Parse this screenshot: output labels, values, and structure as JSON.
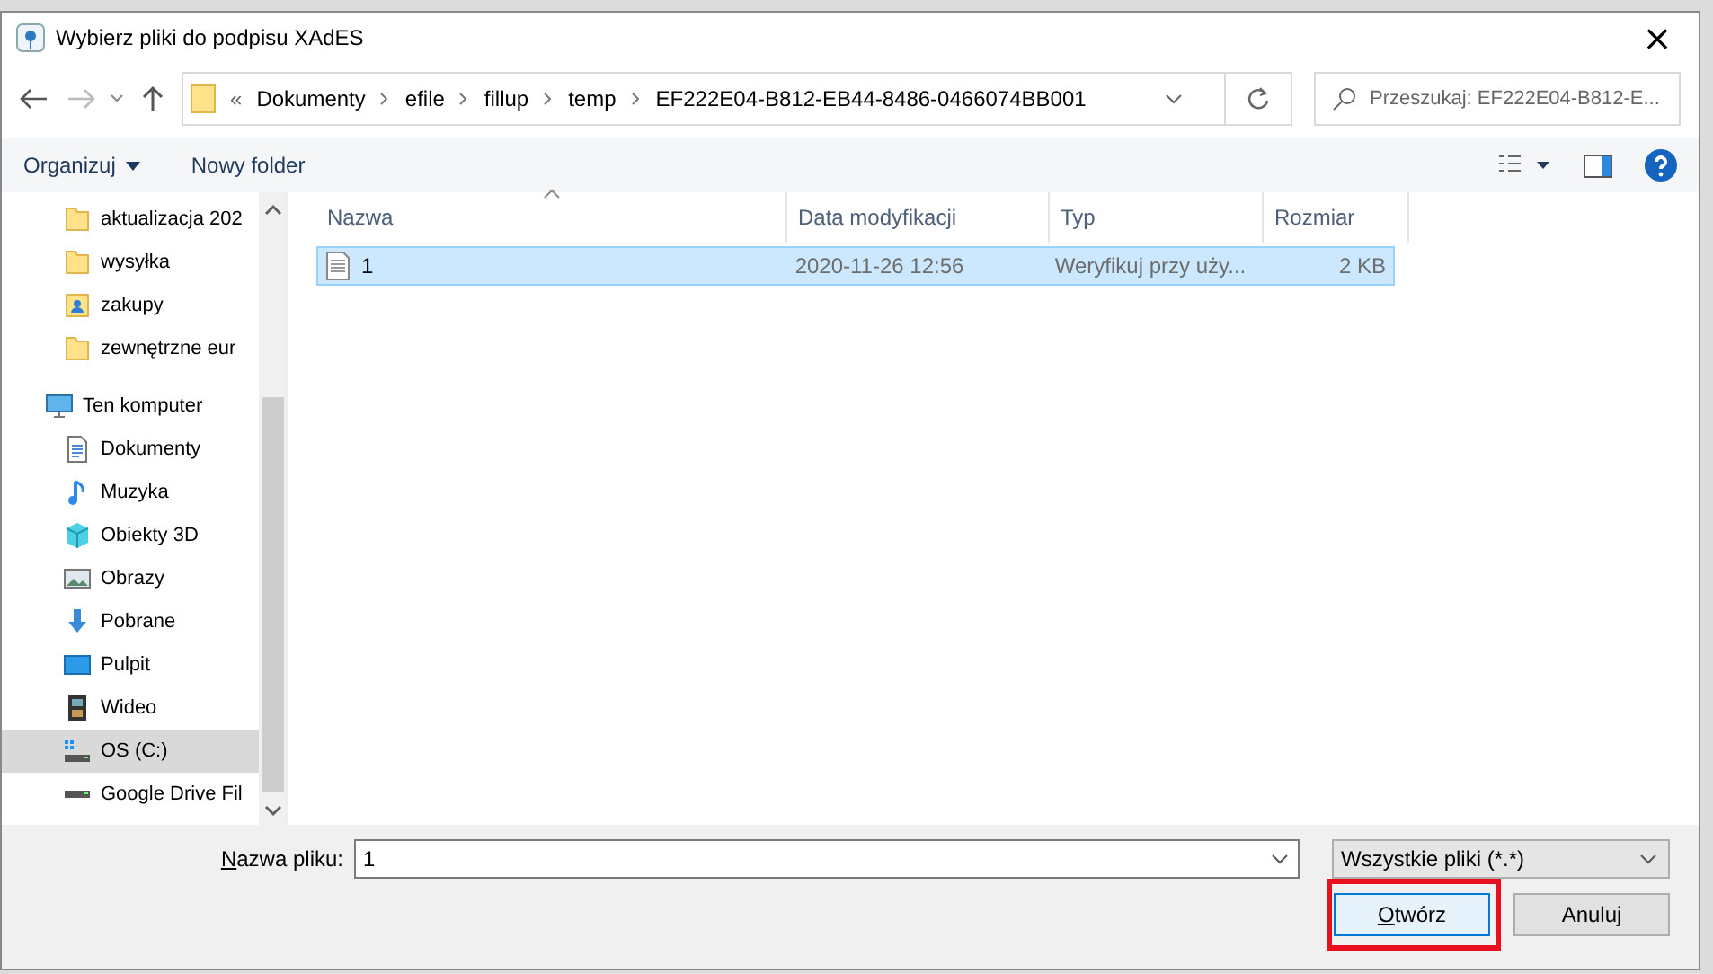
{
  "window": {
    "title": "Wybierz pliki do podpisu XAdES",
    "close": "×"
  },
  "address_bar": {
    "overflow": "«",
    "path": [
      "Dokumenty",
      "efile",
      "fillup",
      "temp",
      "EF222E04-B812-EB44-8486-0466074BB001"
    ]
  },
  "search": {
    "placeholder": "Przeszukaj: EF222E04-B812-E..."
  },
  "toolbar": {
    "organize": "Organizuj",
    "new_folder": "Nowy folder"
  },
  "sidebar": {
    "items": [
      {
        "label": "aktualizacja 202",
        "kind": "folder",
        "selected": false
      },
      {
        "label": "wysyłka",
        "kind": "folder",
        "selected": false
      },
      {
        "label": "zakupy",
        "kind": "user-folder",
        "selected": false
      },
      {
        "label": "zewnętrzne eur",
        "kind": "folder",
        "selected": false
      },
      {
        "label": "Ten komputer",
        "kind": "computer",
        "selected": false,
        "children": [
          {
            "label": "Dokumenty",
            "kind": "document",
            "selected": false
          },
          {
            "label": "Muzyka",
            "kind": "music",
            "selected": false
          },
          {
            "label": "Obiekty 3D",
            "kind": "cube",
            "selected": false
          },
          {
            "label": "Obrazy",
            "kind": "image",
            "selected": false
          },
          {
            "label": "Pobrane",
            "kind": "download",
            "selected": false
          },
          {
            "label": "Pulpit",
            "kind": "desktop",
            "selected": false
          },
          {
            "label": "Wideo",
            "kind": "film",
            "selected": false
          },
          {
            "label": "OS (C:)",
            "kind": "system-drive",
            "selected": true
          },
          {
            "label": "Google Drive Fil",
            "kind": "drive",
            "selected": false
          }
        ]
      }
    ]
  },
  "table": {
    "columns": [
      {
        "label": "Nazwa",
        "sorted": true
      },
      {
        "label": "Data modyfikacji",
        "sorted": false
      },
      {
        "label": "Typ",
        "sorted": false
      },
      {
        "label": "Rozmiar",
        "sorted": false
      }
    ],
    "rows": [
      {
        "cells": [
          "1",
          "2020-11-26 12:56",
          "Weryfikuj przy uży...",
          "2 KB"
        ],
        "selected": true
      }
    ]
  },
  "footer": {
    "filename_label": "Nazwa pliku:",
    "filename": "1",
    "filter": "Wszystkie pliki (*.*)",
    "open_button": {
      "label": "Otwórz",
      "highlighted": true
    },
    "cancel_button": "Anuluj"
  }
}
